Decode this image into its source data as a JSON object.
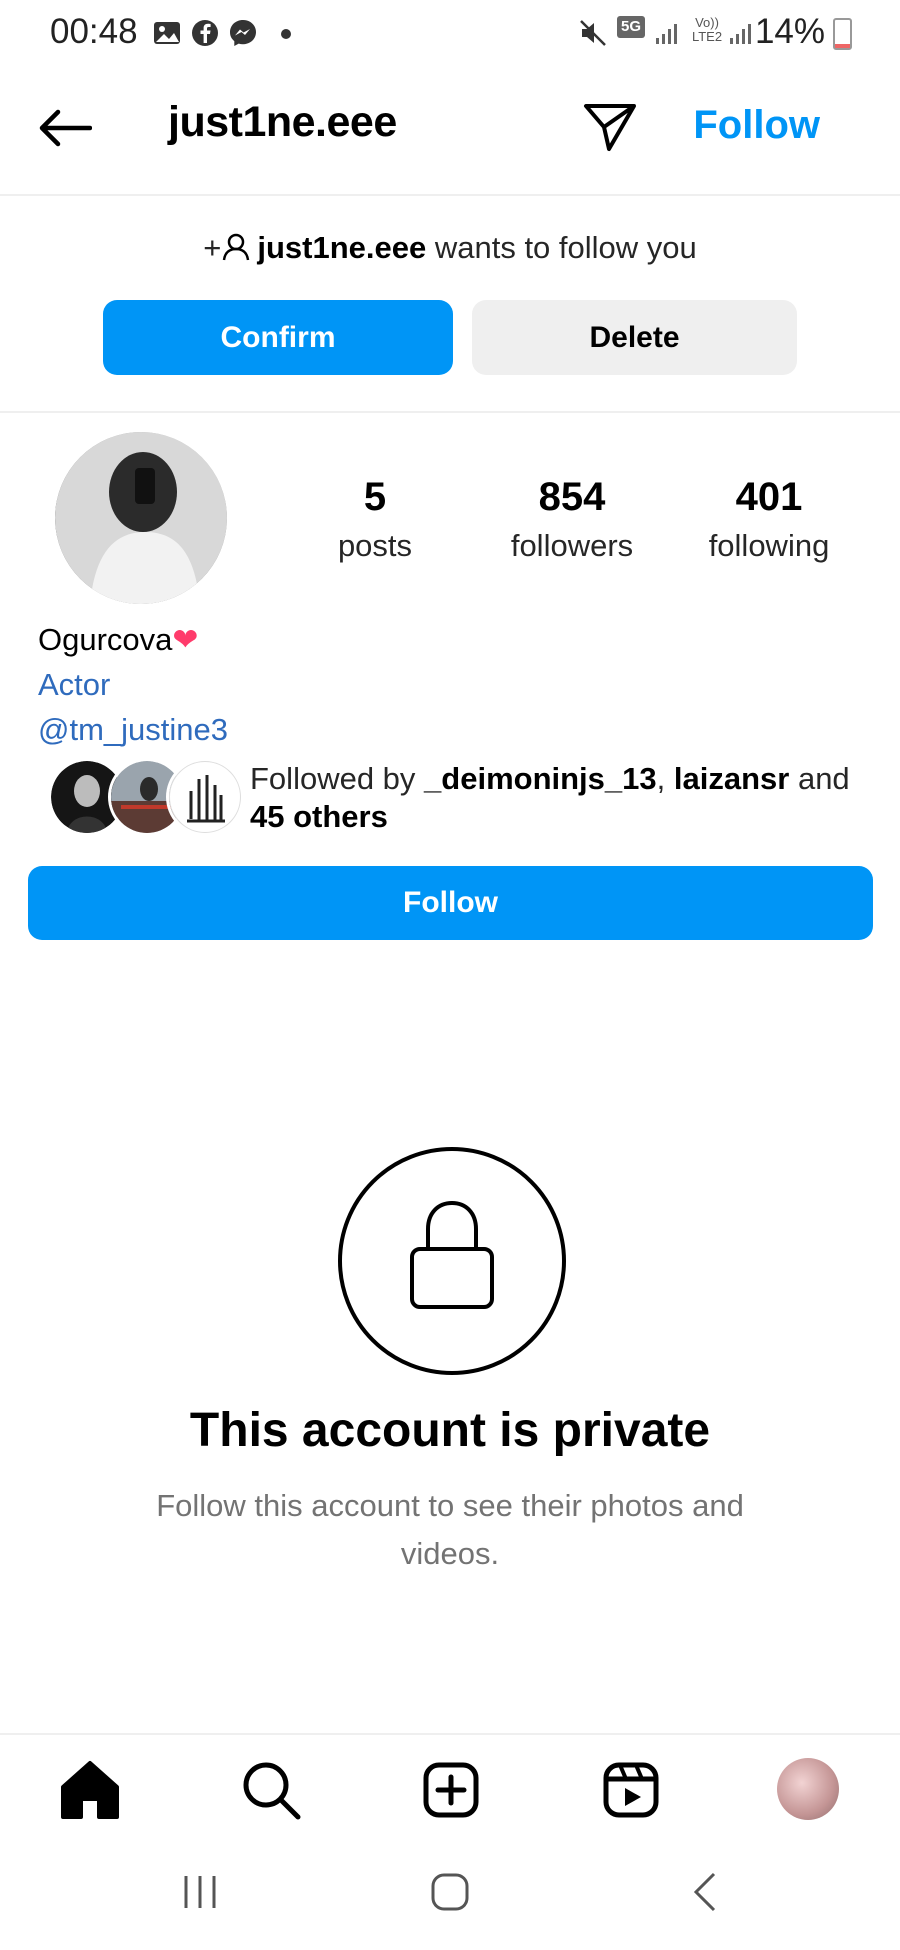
{
  "status_bar": {
    "time": "00:48",
    "battery": "14%",
    "icons": [
      "gallery-icon",
      "facebook-icon",
      "messenger-icon",
      "dot-icon",
      "mute-icon",
      "5g-icon",
      "signal-icon",
      "volte-icon",
      "battery-icon"
    ],
    "network_label": "5G",
    "volte_label": "Vo)) LTE2"
  },
  "header": {
    "title": "just1ne.eee",
    "follow_label": "Follow"
  },
  "request": {
    "prefix": "+",
    "username": "just1ne.eee",
    "text": "wants to follow you",
    "confirm_label": "Confirm",
    "delete_label": "Delete"
  },
  "profile": {
    "stats": [
      {
        "value": "5",
        "label": "posts"
      },
      {
        "value": "854",
        "label": "followers"
      },
      {
        "value": "401",
        "label": "following"
      }
    ],
    "name": "Ogurcova",
    "name_emoji": "❤",
    "category": "Actor",
    "handle": "@tm_justine3",
    "followed_by": {
      "prefix": "Followed by",
      "user1": "_deimoninjs_13",
      "user2": "laizansr",
      "joiner": "and",
      "others": "45 others"
    },
    "follow_button": "Follow"
  },
  "private": {
    "title": "This account is private",
    "subtitle": "Follow this account to see their photos and videos."
  },
  "colors": {
    "accent": "#0095f6",
    "link": "#2f6bbd",
    "secondary_text": "#737373",
    "light_button": "#efefef"
  },
  "bottom_nav": [
    "home-icon",
    "search-icon",
    "create-icon",
    "reels-icon",
    "profile-avatar"
  ],
  "system_nav": [
    "recents-icon",
    "home-circle-icon",
    "back-icon"
  ]
}
